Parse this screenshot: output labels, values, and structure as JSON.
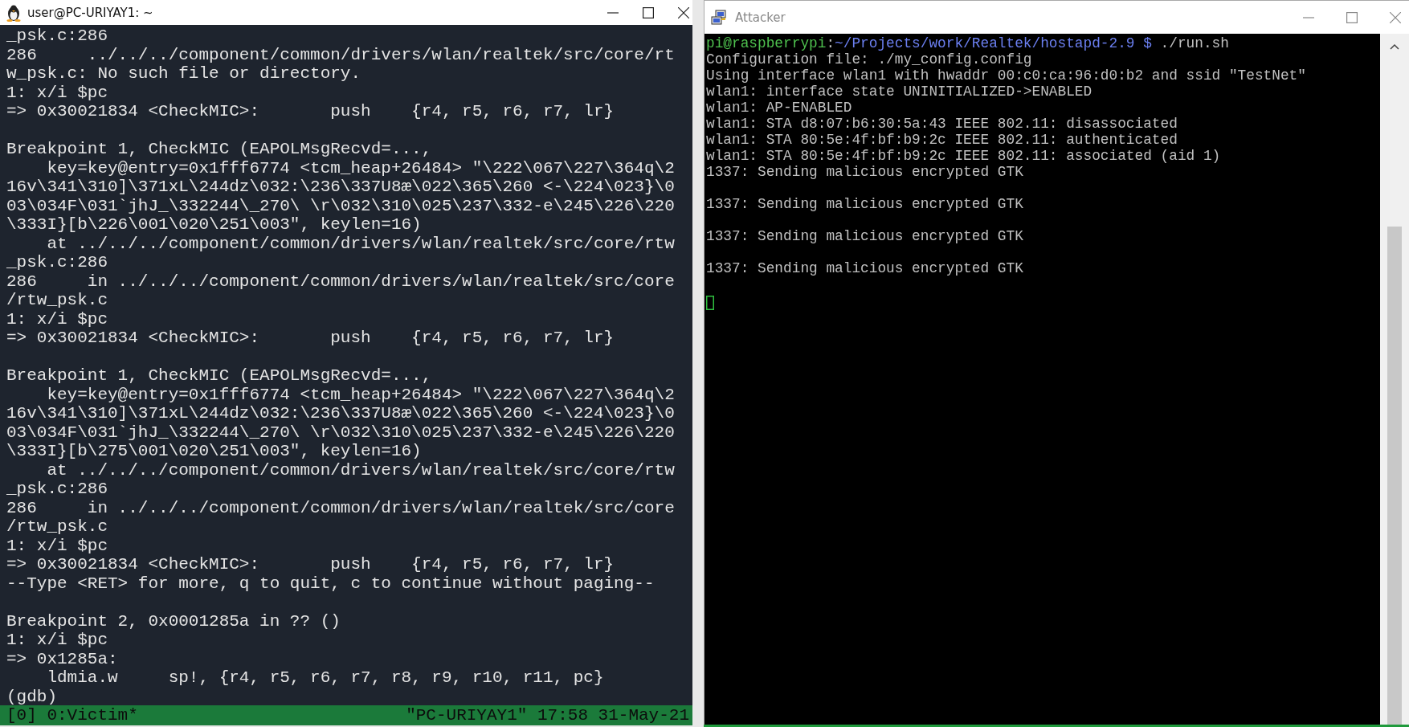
{
  "victim_window": {
    "title": "user@PC-URIYAY1: ~",
    "lines": [
      {
        "kind": "text",
        "text": "_psk.c:286"
      },
      {
        "kind": "text",
        "text": "286     ../../../component/common/drivers/wlan/realtek/src/core/rt"
      },
      {
        "kind": "text",
        "text": "w_psk.c: No such file or directory."
      },
      {
        "kind": "text",
        "text": "1: x/i $pc"
      },
      {
        "kind": "text",
        "text": "=> 0x30021834 <CheckMIC>:       push    {r4, r5, r6, r7, lr}"
      },
      {
        "kind": "blank"
      },
      {
        "kind": "text",
        "text": "Breakpoint 1, CheckMIC (EAPOLMsgRecvd=...,"
      },
      {
        "kind": "text",
        "text": "    key=key@entry=0x1fff6774 <tcm_heap+26484> \"\\222\\067\\227\\364q\\2"
      },
      {
        "kind": "text",
        "text": "16v\\341\\310]\\371xL\\244dz\\032:\\236\\337U8æ\\022\\365\\260 <-\\224\\023}\\0"
      },
      {
        "kind": "text",
        "text": "03\\034F\\031`jhJ_\\332244\\_270\\ \\r\\032\\310\\025\\237\\332-e\\245\\226\\220"
      },
      {
        "kind": "text",
        "text": "\\333I}[b\\226\\001\\020\\251\\003\", keylen=16)"
      },
      {
        "kind": "text",
        "text": "    at ../../../component/common/drivers/wlan/realtek/src/core/rtw"
      },
      {
        "kind": "text",
        "text": "_psk.c:286"
      },
      {
        "kind": "text",
        "text": "286     in ../../../component/common/drivers/wlan/realtek/src/core"
      },
      {
        "kind": "text",
        "text": "/rtw_psk.c"
      },
      {
        "kind": "text",
        "text": "1: x/i $pc"
      },
      {
        "kind": "text",
        "text": "=> 0x30021834 <CheckMIC>:       push    {r4, r5, r6, r7, lr}"
      },
      {
        "kind": "blank"
      },
      {
        "kind": "text",
        "text": "Breakpoint 1, CheckMIC (EAPOLMsgRecvd=...,"
      },
      {
        "kind": "text",
        "text": "    key=key@entry=0x1fff6774 <tcm_heap+26484> \"\\222\\067\\227\\364q\\2"
      },
      {
        "kind": "text",
        "text": "16v\\341\\310]\\371xL\\244dz\\032:\\236\\337U8æ\\022\\365\\260 <-\\224\\023}\\0"
      },
      {
        "kind": "text",
        "text": "03\\034F\\031`jhJ_\\332244\\_270\\ \\r\\032\\310\\025\\237\\332-e\\245\\226\\220"
      },
      {
        "kind": "text",
        "text": "\\333I}[b\\275\\001\\020\\251\\003\", keylen=16)"
      },
      {
        "kind": "text",
        "text": "    at ../../../component/common/drivers/wlan/realtek/src/core/rtw"
      },
      {
        "kind": "text",
        "text": "_psk.c:286"
      },
      {
        "kind": "text",
        "text": "286     in ../../../component/common/drivers/wlan/realtek/src/core"
      },
      {
        "kind": "text",
        "text": "/rtw_psk.c"
      },
      {
        "kind": "text",
        "text": "1: x/i $pc"
      },
      {
        "kind": "text",
        "text": "=> 0x30021834 <CheckMIC>:       push    {r4, r5, r6, r7, lr}"
      },
      {
        "kind": "text",
        "text": "--Type <RET> for more, q to quit, c to continue without paging--"
      },
      {
        "kind": "blank"
      },
      {
        "kind": "text",
        "text": "Breakpoint 2, 0x0001285a in ?? ()"
      },
      {
        "kind": "text",
        "text": "1: x/i $pc"
      },
      {
        "kind": "text",
        "text": "=> 0x1285a:"
      },
      {
        "kind": "text",
        "text": "    ldmia.w     sp!, {r4, r5, r6, r7, r8, r9, r10, r11, pc}"
      },
      {
        "kind": "text",
        "text": "(gdb)"
      }
    ],
    "status_bar": {
      "left": "[0] 0:Victim*",
      "right": "\"PC-URIYAY1\" 17:58 31-May-21"
    }
  },
  "attacker_window": {
    "title": "Attacker",
    "lines": [
      {
        "kind": "prompt",
        "user": "pi@raspberrypi",
        "separator": ":",
        "path": "~/Projects/work/Realtek/hostapd-2.9 $",
        "command": "./run.sh"
      },
      {
        "kind": "text",
        "text": "Configuration file: ./my_config.config"
      },
      {
        "kind": "text",
        "text": "Using interface wlan1 with hwaddr 00:c0:ca:96:d0:b2 and ssid \"TestNet\""
      },
      {
        "kind": "text",
        "text": "wlan1: interface state UNINITIALIZED->ENABLED"
      },
      {
        "kind": "text",
        "text": "wlan1: AP-ENABLED"
      },
      {
        "kind": "text",
        "text": "wlan1: STA d8:07:b6:30:5a:43 IEEE 802.11: disassociated"
      },
      {
        "kind": "text",
        "text": "wlan1: STA 80:5e:4f:bf:b9:2c IEEE 802.11: authenticated"
      },
      {
        "kind": "text",
        "text": "wlan1: STA 80:5e:4f:bf:b9:2c IEEE 802.11: associated (aid 1)"
      },
      {
        "kind": "text",
        "text": "1337: Sending malicious encrypted GTK"
      },
      {
        "kind": "blank"
      },
      {
        "kind": "text",
        "text": "1337: Sending malicious encrypted GTK"
      },
      {
        "kind": "blank"
      },
      {
        "kind": "text",
        "text": "1337: Sending malicious encrypted GTK"
      },
      {
        "kind": "blank"
      },
      {
        "kind": "text",
        "text": "1337: Sending malicious encrypted GTK"
      },
      {
        "kind": "blank"
      },
      {
        "kind": "cursor"
      }
    ]
  }
}
